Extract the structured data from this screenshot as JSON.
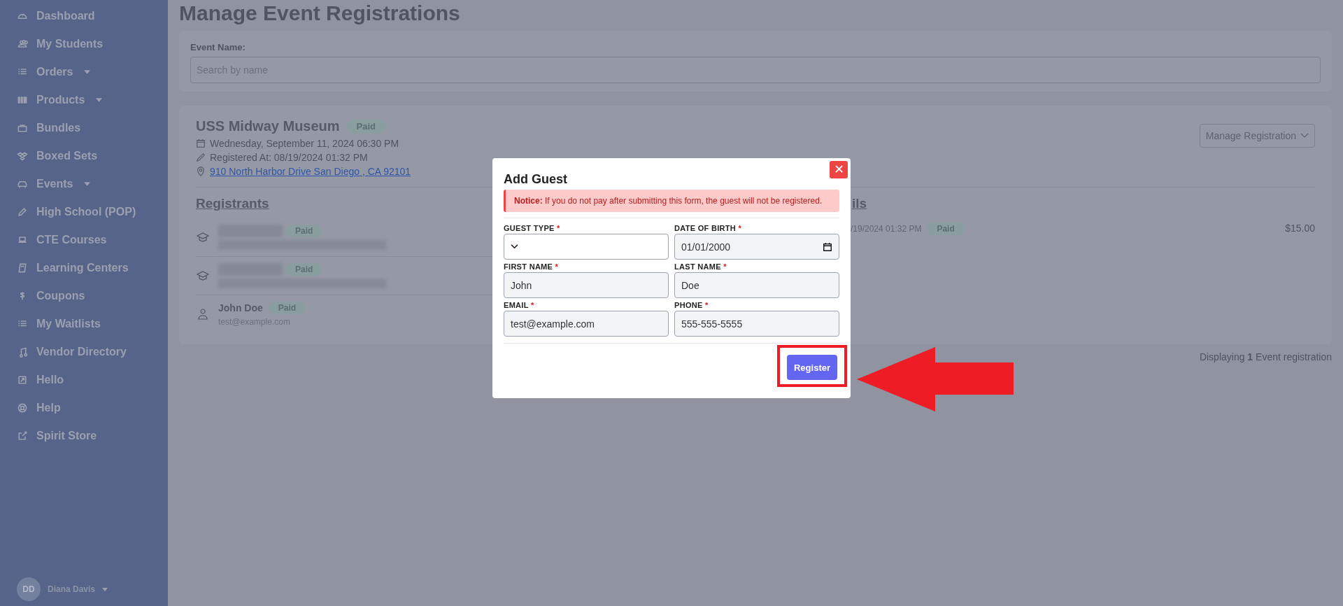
{
  "sidebar": {
    "items": [
      {
        "label": "Dashboard",
        "expandable": false
      },
      {
        "label": "My Students",
        "expandable": false
      },
      {
        "label": "Orders",
        "expandable": true
      },
      {
        "label": "Products",
        "expandable": true
      },
      {
        "label": "Bundles",
        "expandable": false
      },
      {
        "label": "Boxed Sets",
        "expandable": false
      },
      {
        "label": "Events",
        "expandable": true
      },
      {
        "label": "High School (POP)",
        "expandable": false
      },
      {
        "label": "CTE Courses",
        "expandable": false
      },
      {
        "label": "Learning Centers",
        "expandable": false
      },
      {
        "label": "Coupons",
        "expandable": false
      },
      {
        "label": "My Waitlists",
        "expandable": false
      },
      {
        "label": "Vendor Directory",
        "expandable": false
      },
      {
        "label": "Hello",
        "expandable": false
      },
      {
        "label": "Help",
        "expandable": false
      },
      {
        "label": "Spirit Store",
        "expandable": false
      }
    ],
    "user": {
      "initials": "DD",
      "name": "Diana Davis"
    }
  },
  "page": {
    "title": "Manage Event Registrations",
    "search": {
      "label": "Event Name:",
      "placeholder": "Search by name"
    },
    "event": {
      "name": "USS Midway Museum",
      "status": "Paid",
      "date": "Wednesday, September 11, 2024 06:30 PM",
      "registered": "Registered At: 08/19/2024 01:32 PM",
      "address": "910 North Harbor Drive San Diego , CA 92101",
      "manage_button": "Manage Registration",
      "registrants_heading": "Registrants",
      "registrants": [
        {
          "kind": "student",
          "redacted": true,
          "status": "Paid"
        },
        {
          "kind": "student",
          "redacted": true,
          "status": "Paid"
        },
        {
          "kind": "guest",
          "redacted": false,
          "name": "John Doe",
          "status": "Paid",
          "email": "test@example.com"
        }
      ],
      "details_heading": "ils",
      "details": [
        {
          "date": "/19/2024 01:32 PM",
          "status": "Paid",
          "amount": "$15.00"
        }
      ]
    },
    "footer": "Displaying **1** Event registration"
  },
  "modal": {
    "title": "Add Guest",
    "close": "✕",
    "notice": "**Notice:** If you do not pay after submitting this form, the guest will not be registered.",
    "fields": [
      {
        "label": "GUEST TYPE",
        "required_mark": "*",
        "kind": "select"
      },
      {
        "label": "DATE OF BIRTH",
        "required_mark": "*",
        "kind": "date",
        "value": "01/01/2000"
      },
      {
        "label": "FIRST NAME",
        "required_mark": "*",
        "kind": "text",
        "value": "John"
      },
      {
        "label": "LAST NAME",
        "required_mark": "*",
        "kind": "text",
        "value": "Doe"
      },
      {
        "label": "EMAIL",
        "required_mark": "*",
        "kind": "text",
        "value": "test@example.com"
      },
      {
        "label": "PHONE",
        "required_mark": "*",
        "kind": "text",
        "value": "555-555-5555"
      }
    ],
    "register_button": {
      "label": "Register",
      "highlighted": true
    }
  },
  "annotation_arrow": true
}
